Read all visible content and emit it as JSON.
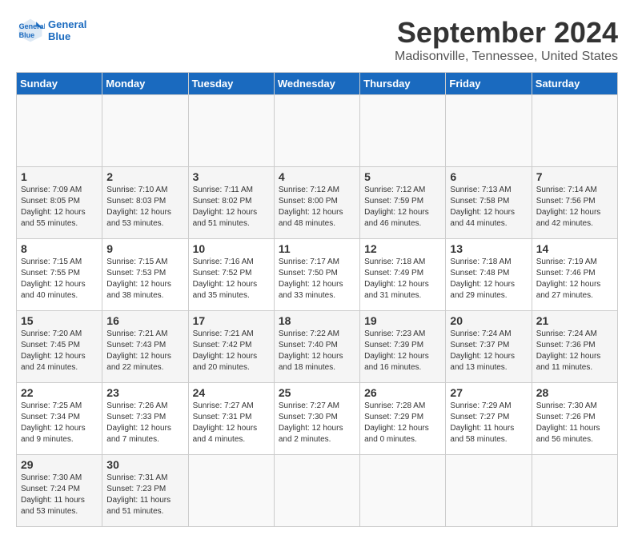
{
  "header": {
    "logo_line1": "General",
    "logo_line2": "Blue",
    "month_title": "September 2024",
    "location": "Madisonville, Tennessee, United States"
  },
  "calendar": {
    "days_of_week": [
      "Sunday",
      "Monday",
      "Tuesday",
      "Wednesday",
      "Thursday",
      "Friday",
      "Saturday"
    ],
    "weeks": [
      [
        {
          "day": "",
          "text": ""
        },
        {
          "day": "",
          "text": ""
        },
        {
          "day": "",
          "text": ""
        },
        {
          "day": "",
          "text": ""
        },
        {
          "day": "",
          "text": ""
        },
        {
          "day": "",
          "text": ""
        },
        {
          "day": "",
          "text": ""
        }
      ],
      [
        {
          "day": "1",
          "text": "Sunrise: 7:09 AM\nSunset: 8:05 PM\nDaylight: 12 hours\nand 55 minutes."
        },
        {
          "day": "2",
          "text": "Sunrise: 7:10 AM\nSunset: 8:03 PM\nDaylight: 12 hours\nand 53 minutes."
        },
        {
          "day": "3",
          "text": "Sunrise: 7:11 AM\nSunset: 8:02 PM\nDaylight: 12 hours\nand 51 minutes."
        },
        {
          "day": "4",
          "text": "Sunrise: 7:12 AM\nSunset: 8:00 PM\nDaylight: 12 hours\nand 48 minutes."
        },
        {
          "day": "5",
          "text": "Sunrise: 7:12 AM\nSunset: 7:59 PM\nDaylight: 12 hours\nand 46 minutes."
        },
        {
          "day": "6",
          "text": "Sunrise: 7:13 AM\nSunset: 7:58 PM\nDaylight: 12 hours\nand 44 minutes."
        },
        {
          "day": "7",
          "text": "Sunrise: 7:14 AM\nSunset: 7:56 PM\nDaylight: 12 hours\nand 42 minutes."
        }
      ],
      [
        {
          "day": "8",
          "text": "Sunrise: 7:15 AM\nSunset: 7:55 PM\nDaylight: 12 hours\nand 40 minutes."
        },
        {
          "day": "9",
          "text": "Sunrise: 7:15 AM\nSunset: 7:53 PM\nDaylight: 12 hours\nand 38 minutes."
        },
        {
          "day": "10",
          "text": "Sunrise: 7:16 AM\nSunset: 7:52 PM\nDaylight: 12 hours\nand 35 minutes."
        },
        {
          "day": "11",
          "text": "Sunrise: 7:17 AM\nSunset: 7:50 PM\nDaylight: 12 hours\nand 33 minutes."
        },
        {
          "day": "12",
          "text": "Sunrise: 7:18 AM\nSunset: 7:49 PM\nDaylight: 12 hours\nand 31 minutes."
        },
        {
          "day": "13",
          "text": "Sunrise: 7:18 AM\nSunset: 7:48 PM\nDaylight: 12 hours\nand 29 minutes."
        },
        {
          "day": "14",
          "text": "Sunrise: 7:19 AM\nSunset: 7:46 PM\nDaylight: 12 hours\nand 27 minutes."
        }
      ],
      [
        {
          "day": "15",
          "text": "Sunrise: 7:20 AM\nSunset: 7:45 PM\nDaylight: 12 hours\nand 24 minutes."
        },
        {
          "day": "16",
          "text": "Sunrise: 7:21 AM\nSunset: 7:43 PM\nDaylight: 12 hours\nand 22 minutes."
        },
        {
          "day": "17",
          "text": "Sunrise: 7:21 AM\nSunset: 7:42 PM\nDaylight: 12 hours\nand 20 minutes."
        },
        {
          "day": "18",
          "text": "Sunrise: 7:22 AM\nSunset: 7:40 PM\nDaylight: 12 hours\nand 18 minutes."
        },
        {
          "day": "19",
          "text": "Sunrise: 7:23 AM\nSunset: 7:39 PM\nDaylight: 12 hours\nand 16 minutes."
        },
        {
          "day": "20",
          "text": "Sunrise: 7:24 AM\nSunset: 7:37 PM\nDaylight: 12 hours\nand 13 minutes."
        },
        {
          "day": "21",
          "text": "Sunrise: 7:24 AM\nSunset: 7:36 PM\nDaylight: 12 hours\nand 11 minutes."
        }
      ],
      [
        {
          "day": "22",
          "text": "Sunrise: 7:25 AM\nSunset: 7:34 PM\nDaylight: 12 hours\nand 9 minutes."
        },
        {
          "day": "23",
          "text": "Sunrise: 7:26 AM\nSunset: 7:33 PM\nDaylight: 12 hours\nand 7 minutes."
        },
        {
          "day": "24",
          "text": "Sunrise: 7:27 AM\nSunset: 7:31 PM\nDaylight: 12 hours\nand 4 minutes."
        },
        {
          "day": "25",
          "text": "Sunrise: 7:27 AM\nSunset: 7:30 PM\nDaylight: 12 hours\nand 2 minutes."
        },
        {
          "day": "26",
          "text": "Sunrise: 7:28 AM\nSunset: 7:29 PM\nDaylight: 12 hours\nand 0 minutes."
        },
        {
          "day": "27",
          "text": "Sunrise: 7:29 AM\nSunset: 7:27 PM\nDaylight: 11 hours\nand 58 minutes."
        },
        {
          "day": "28",
          "text": "Sunrise: 7:30 AM\nSunset: 7:26 PM\nDaylight: 11 hours\nand 56 minutes."
        }
      ],
      [
        {
          "day": "29",
          "text": "Sunrise: 7:30 AM\nSunset: 7:24 PM\nDaylight: 11 hours\nand 53 minutes."
        },
        {
          "day": "30",
          "text": "Sunrise: 7:31 AM\nSunset: 7:23 PM\nDaylight: 11 hours\nand 51 minutes."
        },
        {
          "day": "",
          "text": ""
        },
        {
          "day": "",
          "text": ""
        },
        {
          "day": "",
          "text": ""
        },
        {
          "day": "",
          "text": ""
        },
        {
          "day": "",
          "text": ""
        }
      ]
    ]
  }
}
